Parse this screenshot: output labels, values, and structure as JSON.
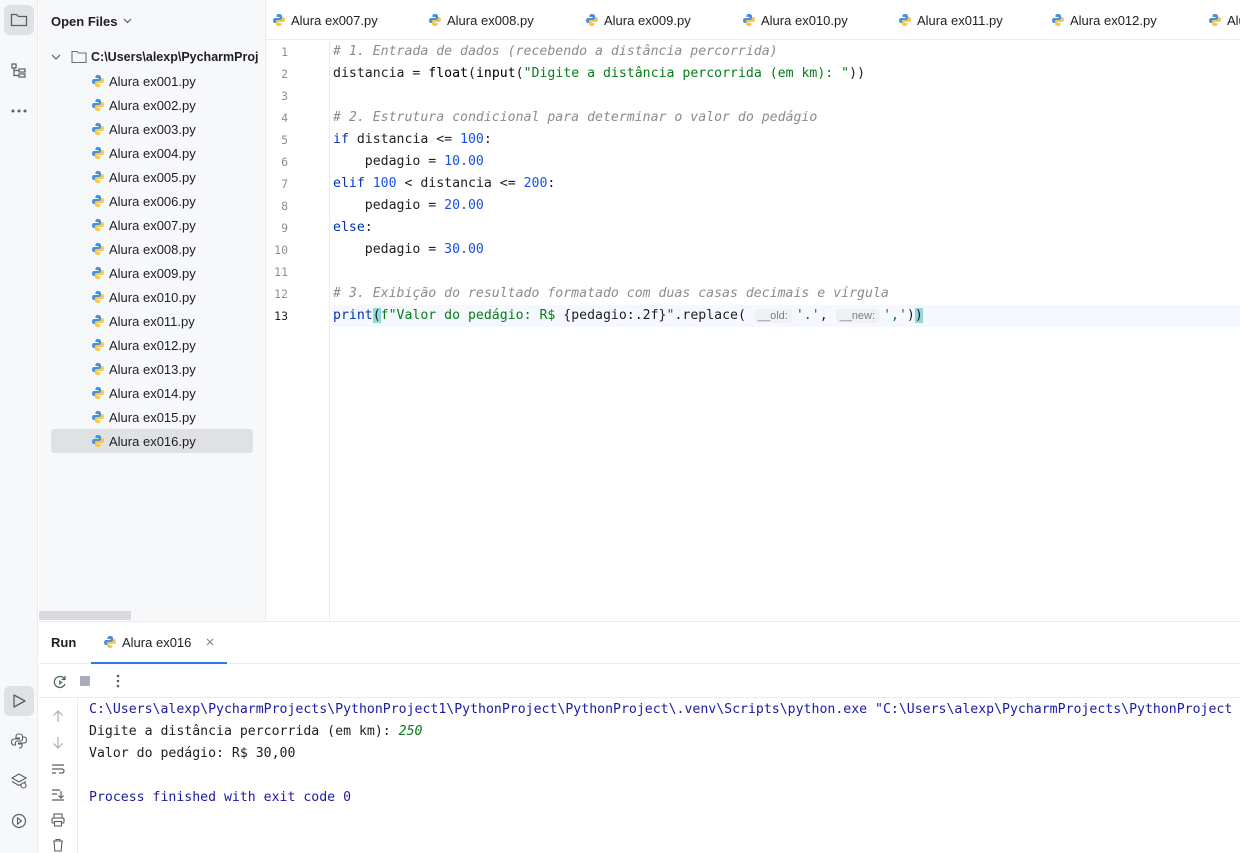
{
  "project": {
    "header": "Open Files",
    "root": "C:\\Users\\alexp\\PycharmProj",
    "files": [
      "Alura ex001.py",
      "Alura ex002.py",
      "Alura ex003.py",
      "Alura ex004.py",
      "Alura ex005.py",
      "Alura ex006.py",
      "Alura ex007.py",
      "Alura ex008.py",
      "Alura ex009.py",
      "Alura ex010.py",
      "Alura ex011.py",
      "Alura ex012.py",
      "Alura ex013.py",
      "Alura ex014.py",
      "Alura ex015.py",
      "Alura ex016.py"
    ],
    "selected": "Alura ex016.py"
  },
  "tabs": [
    "Alura ex007.py",
    "Alura ex008.py",
    "Alura ex009.py",
    "Alura ex010.py",
    "Alura ex011.py",
    "Alura ex012.py",
    "Alu"
  ],
  "editor": {
    "line_numbers": [
      "1",
      "2",
      "3",
      "4",
      "5",
      "6",
      "7",
      "8",
      "9",
      "10",
      "11",
      "12",
      "13"
    ],
    "current_line": "13",
    "code": {
      "l1": "# 1. Entrada de dados (recebendo a distância percorrida)",
      "l2_a": "distancia = ",
      "l2_b": "float",
      "l2_c": "(",
      "l2_d": "input",
      "l2_e": "(",
      "l2_f": "\"Digite a distância percorrida (em km): \"",
      "l2_g": "))",
      "l4": "# 2. Estrutura condicional para determinar o valor do pedágio",
      "l5_a": "if",
      "l5_b": " distancia <= ",
      "l5_c": "100",
      "l5_d": ":",
      "l6_a": "    pedagio = ",
      "l6_b": "10.00",
      "l7_a": "elif",
      "l7_b": " ",
      "l7_c": "100",
      "l7_d": " < distancia <= ",
      "l7_e": "200",
      "l7_f": ":",
      "l8_a": "    pedagio = ",
      "l8_b": "20.00",
      "l9_a": "else",
      "l9_b": ":",
      "l10_a": "    pedagio = ",
      "l10_b": "30.00",
      "l12": "# 3. Exibição do resultado formatado com duas casas decimais e vírgula",
      "l13_a": "print",
      "l13_b": "(",
      "l13_c": "f\"Valor do pedágio: R$ ",
      "l13_d": "{pedagio:.2f}",
      "l13_e": "\"",
      "l13_f": ".replace(",
      "l13_hint1": "__old:",
      "l13_g": "'.'",
      "l13_h": ", ",
      "l13_hint2": "__new:",
      "l13_i": "','",
      "l13_j": ")",
      "l13_k": ")"
    }
  },
  "run": {
    "label": "Run",
    "tab": "Alura ex016",
    "output": {
      "cmd": "C:\\Users\\alexp\\PycharmProjects\\PythonProject1\\PythonProject\\PythonProject\\.venv\\Scripts\\python.exe \"C:\\Users\\alexp\\PycharmProjects\\PythonProject",
      "prompt": "Digite a distância percorrida (em km): ",
      "input": "250",
      "result": "Valor do pedágio: R$ 30,00",
      "exit": "Process finished with exit code 0"
    }
  }
}
